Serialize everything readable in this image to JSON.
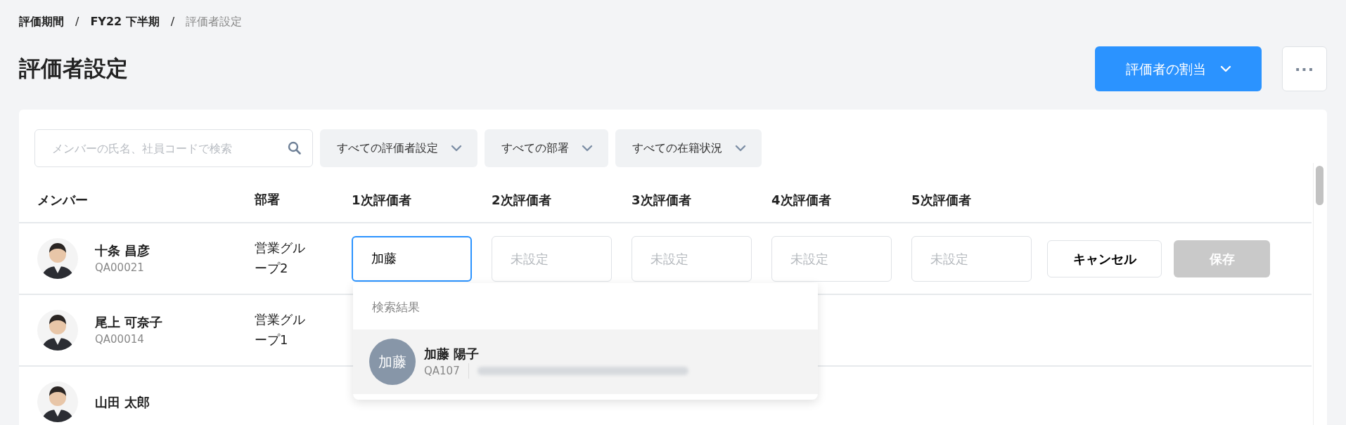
{
  "breadcrumb": [
    {
      "label": "評価期間",
      "current": false
    },
    {
      "label": "FY22 下半期",
      "current": false
    },
    {
      "label": "評価者設定",
      "current": true
    }
  ],
  "breadcrumb_separator": "/",
  "title": "評価者設定",
  "assign_button": {
    "label": "評価者の割当"
  },
  "more_button": {
    "label": "···"
  },
  "search": {
    "placeholder": "メンバーの氏名、社員コードで検索"
  },
  "filters": [
    {
      "label": "すべての評価者設定"
    },
    {
      "label": "すべての部署"
    },
    {
      "label": "すべての在籍状況"
    }
  ],
  "table": {
    "columns": [
      "メンバー",
      "部署",
      "1次評価者",
      "2次評価者",
      "3次評価者",
      "4次評価者",
      "5次評価者"
    ],
    "rows": [
      {
        "name": "十条 昌彦",
        "code": "QA00021",
        "department": "営業グループ2",
        "editing": true,
        "evaluators": [
          {
            "value": "加藤",
            "focused": true
          },
          {
            "placeholder": "未設定",
            "focused": false
          },
          {
            "placeholder": "未設定",
            "focused": false
          },
          {
            "placeholder": "未設定",
            "focused": false
          },
          {
            "placeholder": "未設定",
            "focused": false
          }
        ],
        "cancel": {
          "label": "キャンセル"
        },
        "save": {
          "label": "保存",
          "disabled": true
        }
      },
      {
        "name": "尾上 可奈子",
        "code": "QA00014",
        "department": "営業グループ1",
        "editing": false
      },
      {
        "name": "山田 太郎",
        "editing": false
      }
    ]
  },
  "search_results": {
    "header": "検索結果",
    "items": [
      {
        "initials": "加藤",
        "name": "加藤 陽子",
        "code": "QA107",
        "email_blurred": true,
        "selected": true
      }
    ]
  }
}
